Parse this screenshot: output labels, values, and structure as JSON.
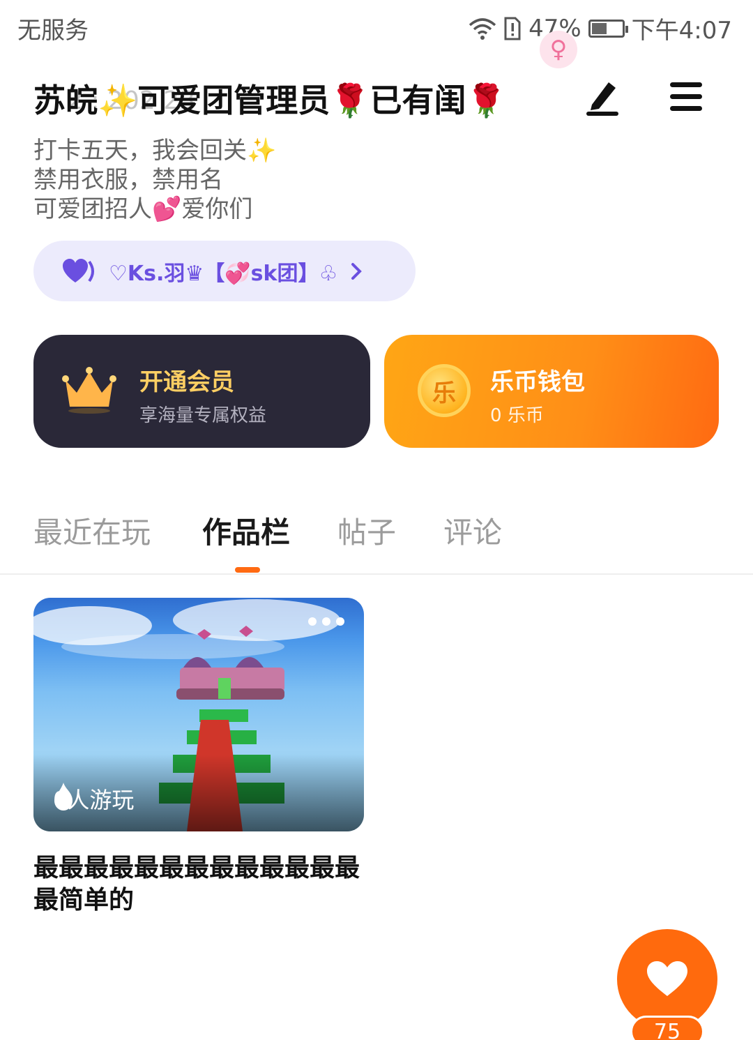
{
  "status_bar": {
    "carrier": "无服务",
    "battery_percent": "47%",
    "battery_level": 0.47,
    "time": "下午4:07"
  },
  "profile": {
    "name": "苏皖✨可爱团管理员🌹已有闺🌹",
    "overlap_text": "2  :  202  23",
    "gender_symbol": "♀",
    "bio_lines": [
      "打卡五天，我会回关✨",
      "禁用衣服，禁用名",
      "可爱团招人💕爱你们"
    ]
  },
  "group": {
    "label": "♡Ks.羽♛【💞sk团】♧"
  },
  "vip_card": {
    "title": "开通会员",
    "subtitle": "享海量专属权益"
  },
  "wallet_card": {
    "coin_char": "乐",
    "title": "乐币钱包",
    "subtitle": "0 乐币"
  },
  "tabs": [
    {
      "label": "最近在玩",
      "active": false
    },
    {
      "label": "作品栏",
      "active": true
    },
    {
      "label": "帖子",
      "active": false
    },
    {
      "label": "评论",
      "active": false
    }
  ],
  "work": {
    "plays": "0人游玩",
    "title": "最最最最最最最最最最最最最最简单的"
  },
  "like": {
    "count": "75"
  },
  "colors": {
    "accent": "#ff6a12",
    "vip_bg": "#2a2838",
    "vip_title": "#ffcf63",
    "group_bg": "#ecebfc",
    "group_text": "#6a4fe0"
  }
}
